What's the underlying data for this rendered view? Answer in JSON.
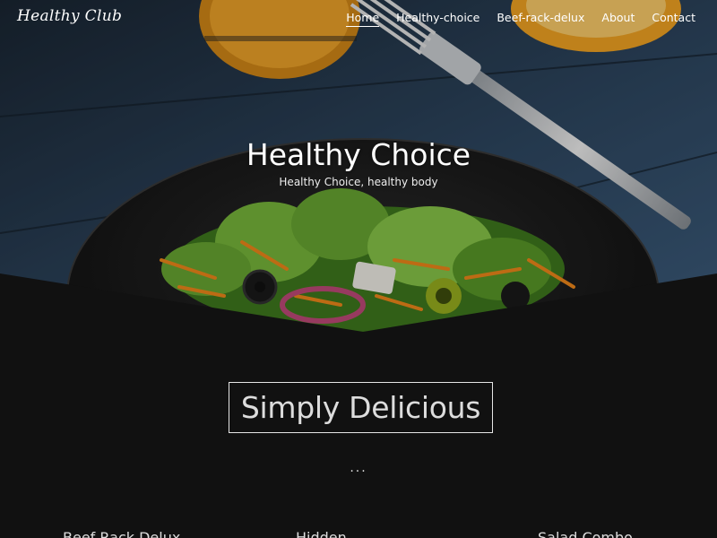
{
  "brand": "Healthy Club",
  "nav": {
    "items": [
      {
        "label": "Home",
        "active": true
      },
      {
        "label": "Healthy-choice",
        "active": false
      },
      {
        "label": "Beef-rack-delux",
        "active": false
      },
      {
        "label": "About",
        "active": false
      },
      {
        "label": "Contact",
        "active": false
      }
    ]
  },
  "hero": {
    "title": "Healthy Choice",
    "subtitle": "Healthy Choice, healthy body"
  },
  "section": {
    "title": "Simply Delicious",
    "dots": "..."
  },
  "cards": [
    {
      "label": "Beef Rack Delux"
    },
    {
      "label": "Hidden..."
    },
    {
      "label": "Salad Combo"
    }
  ],
  "colors": {
    "background": "#111111",
    "text": "#ffffff",
    "accent_orange": "#f2a623"
  }
}
